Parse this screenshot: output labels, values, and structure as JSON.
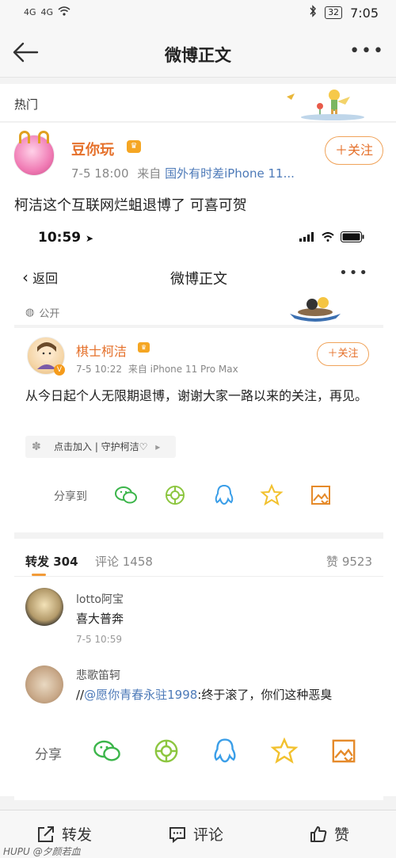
{
  "status_bar": {
    "signal_1": "4G",
    "signal_2": "4G",
    "battery": "32",
    "time": "7:05"
  },
  "nav": {
    "title": "微博正文"
  },
  "hot_label": "热门",
  "post": {
    "username": "豆你玩",
    "date": "7-5 18:00",
    "source_prefix": "来自",
    "source": "国外有时差iPhone 11...",
    "follow_label": "＋关注",
    "text": "柯洁这个互联网烂蛆退博了 可喜可贺"
  },
  "embedded": {
    "time": "10:59",
    "back_label": "返回",
    "title": "微博正文",
    "public_label": "公开",
    "author": {
      "name": "棋士柯洁",
      "date": "7-5 10:22",
      "source": "来自 iPhone 11 Pro Max",
      "follow_label": "＋关注"
    },
    "text": "从今日起个人无限期退博，谢谢大家一路以来的关注，再见。",
    "group_label": "点击加入 | 守护柯洁♡",
    "share_label": "分享到",
    "tabs": {
      "forward": "转发 304",
      "comment": "评论 1458",
      "like": "赞 9523"
    },
    "comments": [
      {
        "name": "lotto阿宝",
        "text": "喜大普奔",
        "time": "7-5 10:59"
      },
      {
        "name": "悲歌笛轲",
        "prefix": "//",
        "mention": "@愿你青春永驻1998",
        "text": ":终于滚了，你们这种恶臭"
      }
    ]
  },
  "share_bar": {
    "label": "分享"
  },
  "bottom_bar": {
    "forward": "转发",
    "comment": "评论",
    "like": "赞"
  },
  "watermark": "HUPU @夕颜若血",
  "colors": {
    "accent_orange": "#e5702a",
    "link_blue": "#4d7ab8",
    "wechat_green": "#3bb54a",
    "qq_blue": "#3a9ee8",
    "star_gold": "#f2c12e"
  }
}
